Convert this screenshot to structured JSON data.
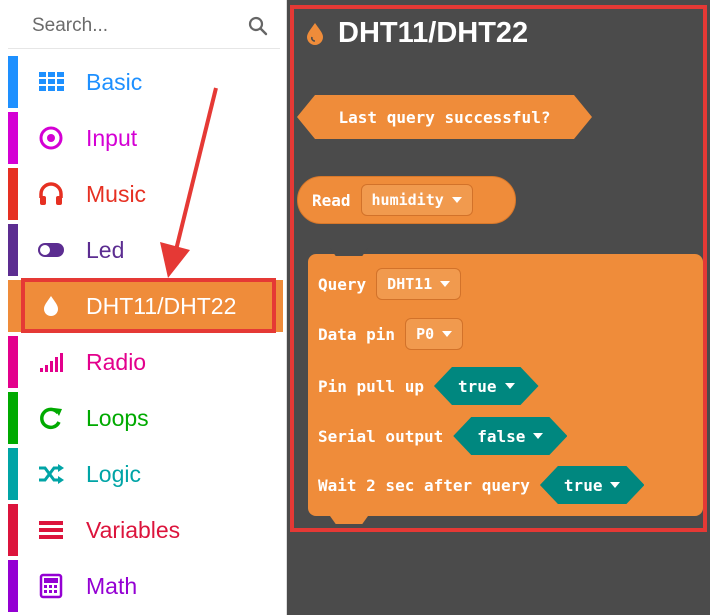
{
  "search": {
    "placeholder": "Search..."
  },
  "categories": [
    {
      "label": "Basic",
      "color": "#1e90ff",
      "icon": "grid-icon"
    },
    {
      "label": "Input",
      "color": "#d400d4",
      "icon": "target-icon"
    },
    {
      "label": "Music",
      "color": "#e63022",
      "icon": "headphones-icon"
    },
    {
      "label": "Led",
      "color": "#5c2d91",
      "icon": "toggle-icon"
    },
    {
      "label": "DHT11/DHT22",
      "color": "#ef8c3a",
      "icon": "drop-icon",
      "selected": true
    },
    {
      "label": "Radio",
      "color": "#e3008c",
      "icon": "signal-bars-icon"
    },
    {
      "label": "Loops",
      "color": "#00aa00",
      "icon": "loop-icon"
    },
    {
      "label": "Logic",
      "color": "#00a4a6",
      "icon": "shuffle-icon"
    },
    {
      "label": "Variables",
      "color": "#dc143c",
      "icon": "lines-icon"
    },
    {
      "label": "Math",
      "color": "#9400d3",
      "icon": "calculator-icon"
    }
  ],
  "flyout": {
    "title": "DHT11/DHT22",
    "color": "#ef8c3a",
    "blocks": {
      "last_query": "Last query successful?",
      "read": {
        "label": "Read",
        "value": "humidity"
      },
      "query": {
        "query_label": "Query",
        "query_value": "DHT11",
        "pin_label": "Data pin",
        "pin_value": "P0",
        "pullup_label": "Pin pull up",
        "pullup_value": "true",
        "serial_label": "Serial output",
        "serial_value": "false",
        "wait_label": "Wait 2 sec after query",
        "wait_value": "true"
      }
    }
  }
}
